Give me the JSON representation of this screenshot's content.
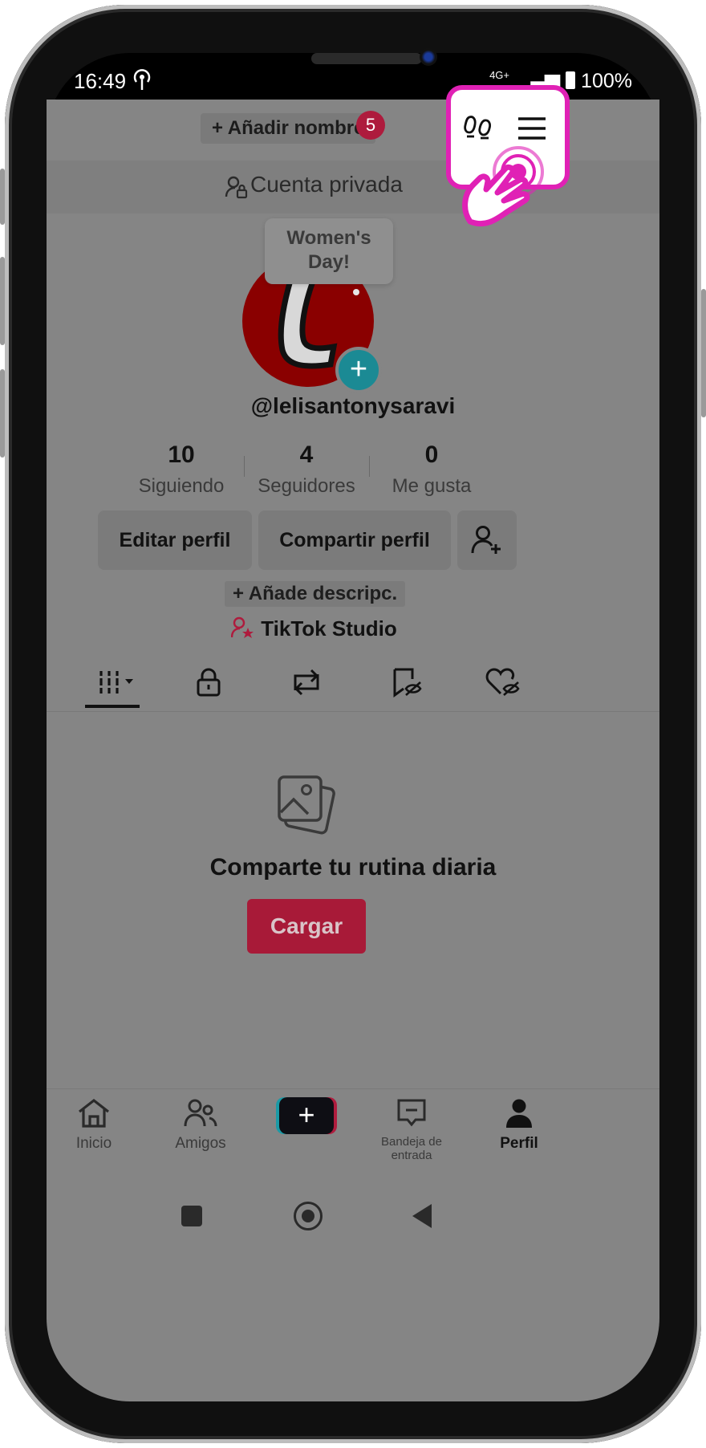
{
  "status_bar": {
    "time": "16:49",
    "signal": "4G+",
    "battery": "100%"
  },
  "header": {
    "add_name_label": "+ Añadir nombre",
    "notification_count": "5"
  },
  "privacy_bar": {
    "label": "Cuenta privada"
  },
  "tooltip": {
    "line1": "Women's",
    "line2": "Day!"
  },
  "profile": {
    "username": "@lelisantonysaravi",
    "stats": [
      {
        "value": "10",
        "label": "Siguiendo"
      },
      {
        "value": "4",
        "label": "Seguidores"
      },
      {
        "value": "0",
        "label": "Me gusta"
      }
    ],
    "edit_label": "Editar perfil",
    "share_label": "Compartir perfil",
    "add_description": "+ Añade descripc.",
    "studio_label": "TikTok Studio"
  },
  "tabs": [
    {
      "icon": "grid-icon"
    },
    {
      "icon": "lock-icon"
    },
    {
      "icon": "repost-icon"
    },
    {
      "icon": "bookmark-hidden-icon"
    },
    {
      "icon": "liked-hidden-icon"
    }
  ],
  "empty_state": {
    "title": "Comparte tu rutina diaria",
    "upload_label": "Cargar"
  },
  "bottom_nav": {
    "items": [
      {
        "label": "Inicio",
        "icon": "home-icon"
      },
      {
        "label": "Amigos",
        "icon": "friends-icon"
      },
      {
        "label": "",
        "icon": "create-icon"
      },
      {
        "label": "Bandeja de entrada",
        "icon": "inbox-icon"
      },
      {
        "label": "Perfil",
        "icon": "profile-icon"
      }
    ]
  },
  "colors": {
    "highlight": "#e021b5",
    "badge": "#ae1b3d",
    "upload": "#a81a38",
    "avatar": "#8a0000",
    "accent_teal": "#1b8a94"
  }
}
